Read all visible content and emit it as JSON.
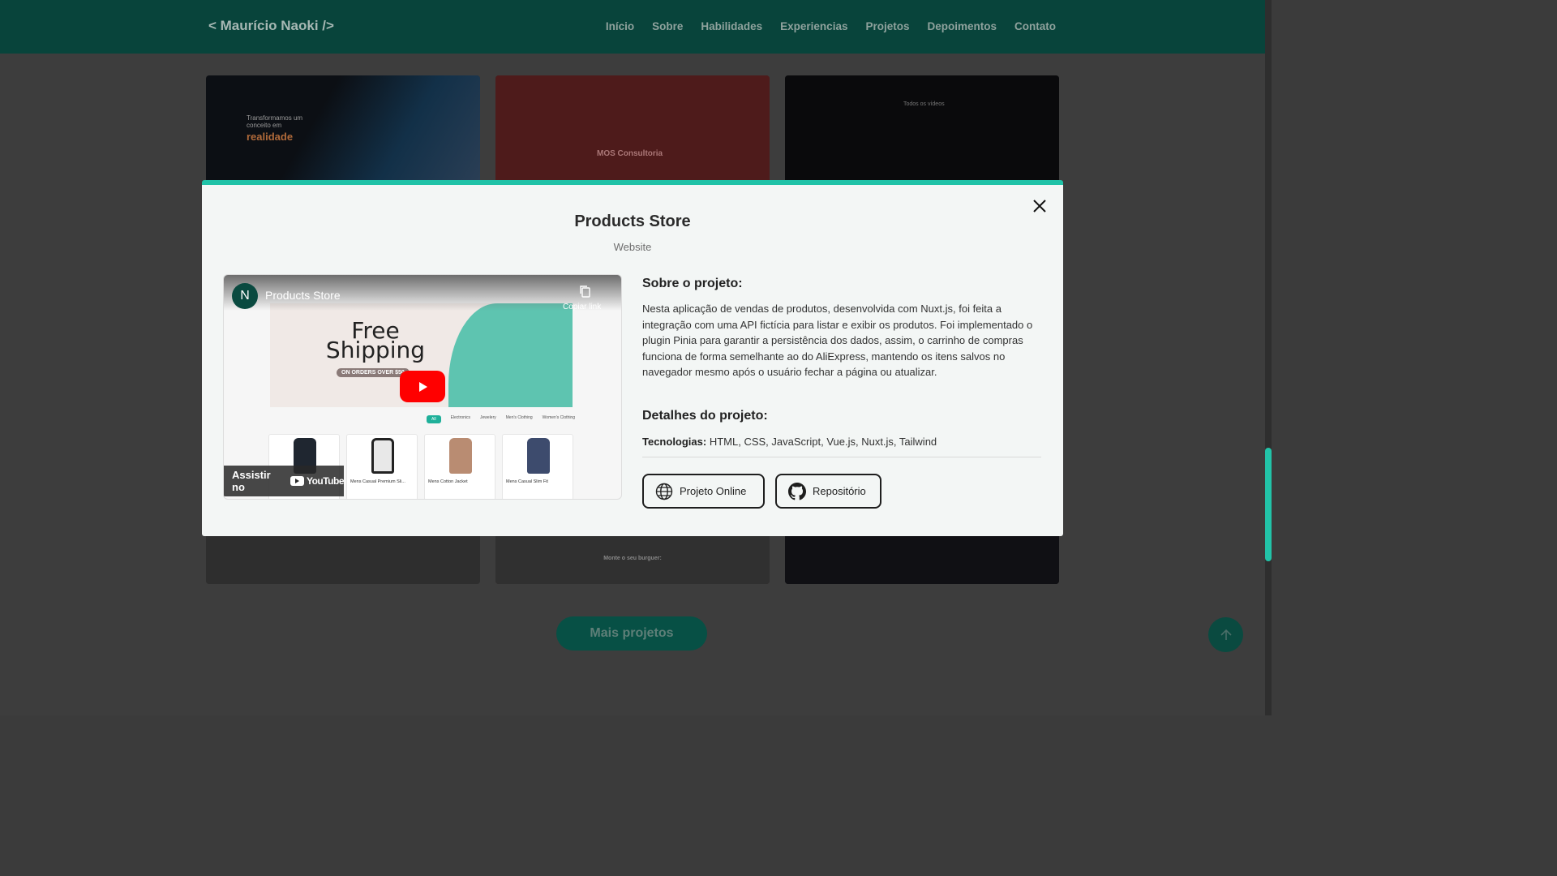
{
  "navbar": {
    "brand": "< Maurício Naoki />",
    "links": [
      "Início",
      "Sobre",
      "Habilidades",
      "Experiencias",
      "Projetos",
      "Depoimentos",
      "Contato"
    ]
  },
  "background_cards": {
    "card1": {
      "headline": "Transformamos um conceito em",
      "highlight": "realidade"
    },
    "card2": {
      "title": "MOS Consultoria"
    },
    "card3": {
      "title": "Todos os vídeos"
    },
    "burger_text": "Monte o seu burguer:"
  },
  "more_projects_label": "Mais projetos",
  "modal": {
    "title": "Products Store",
    "subtitle": "Website",
    "video": {
      "channel_initial": "N",
      "title": "Products Store",
      "copy_link": "Copiar link",
      "banner_line1": "Free",
      "banner_line2": "Shipping",
      "banner_pill": "ON ORDERS OVER $50",
      "categories": [
        "All",
        "Electronics",
        "Jewelery",
        "Men's Clothing",
        "Women's Clothing"
      ],
      "products": [
        "",
        "Mens Casual Premium Sli...",
        "Mens Cotton Jacket",
        "Mens Casual Slim Fit"
      ],
      "watch_on": "Assistir no",
      "youtube": "YouTube"
    },
    "about_heading": "Sobre o projeto:",
    "about_text": "Nesta aplicação de vendas de produtos, desenvolvida com Nuxt.js, foi feita a integração com uma API fictícia para listar e exibir os produtos. Foi implementado o plugin Pinia para garantir a persistência dos dados, assim, o carrinho de compras funciona de forma semelhante ao do AliExpress, mantendo os itens salvos no navegador mesmo após o usuário fechar a página ou atualizar.",
    "details_heading": "Detalhes do projeto:",
    "tech_label": "Tecnologias:",
    "tech_value": "HTML, CSS, JavaScript, Vue.js, Nuxt.js, Tailwind",
    "online_button": "Projeto Online",
    "repo_button": "Repositório"
  },
  "colors": {
    "accent": "#1fc2a7",
    "nav_bg": "#08443b",
    "youtube_red": "#ff0000"
  }
}
